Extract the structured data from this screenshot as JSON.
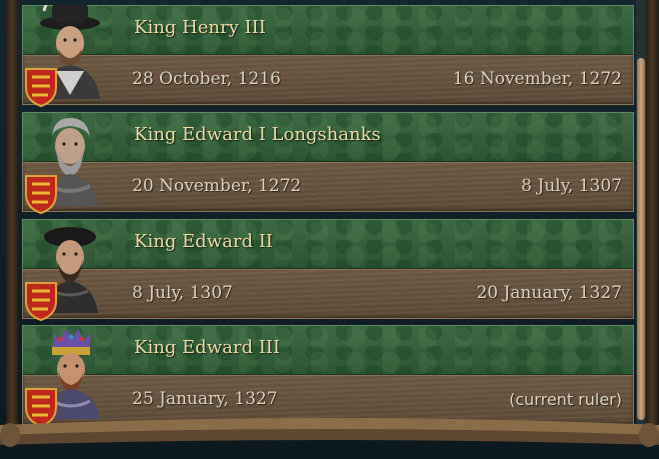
{
  "rulers": [
    {
      "name": "King Henry III",
      "start": "28 October, 1216",
      "end": "16 November, 1272",
      "portrait": "henry-iii-portrait-icon"
    },
    {
      "name": "King Edward I Longshanks",
      "start": "20 November, 1272",
      "end": "8 July, 1307",
      "portrait": "edward-i-portrait-icon"
    },
    {
      "name": "King Edward II",
      "start": "8 July, 1307",
      "end": "20 January, 1327",
      "portrait": "edward-ii-portrait-icon"
    },
    {
      "name": "King Edward III",
      "start": "25 January, 1327",
      "end": "(current ruler)",
      "portrait": "edward-iii-portrait-icon"
    }
  ],
  "coat_of_arms": "england-lions-shield-icon",
  "colors": {
    "header_green": "#2c5533",
    "body_brown": "#5e4c38",
    "name_text": "#e9d9a4",
    "date_text": "#d9d0c2"
  }
}
